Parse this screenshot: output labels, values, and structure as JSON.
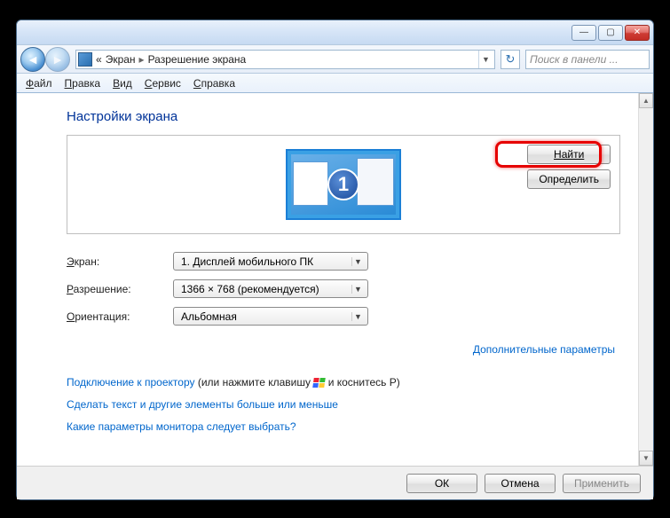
{
  "titlebar": {
    "min": "—",
    "max": "▢",
    "close": "✕"
  },
  "nav": {
    "back": "◄",
    "fwd": "►",
    "chevron": "«",
    "crumb1": "Экран",
    "crumb2": "Разрешение экрана",
    "refresh": "↻",
    "search_placeholder": "Поиск в панели ..."
  },
  "menu": {
    "file": "Файл",
    "edit": "Правка",
    "view": "Вид",
    "tools": "Сервис",
    "help": "Справка"
  },
  "page": {
    "title": "Настройки экрана",
    "display_number": "1",
    "find": "Найти",
    "detect": "Определить"
  },
  "form": {
    "display_label": "Экран:",
    "display_value": "1. Дисплей мобильного ПК",
    "resolution_label": "Разрешение:",
    "resolution_value": "1366 × 768 (рекомендуется)",
    "orientation_label": "Ориентация:",
    "orientation_value": "Альбомная",
    "advanced": "Дополнительные параметры"
  },
  "links": {
    "projector": "Подключение к проектору",
    "projector_tail1": " (или нажмите клавишу ",
    "projector_tail2": " и коснитесь P)",
    "textsize": "Сделать текст и другие элементы больше или меньше",
    "whichmonitor": "Какие параметры монитора следует выбрать?"
  },
  "footer": {
    "ok": "ОК",
    "cancel": "Отмена",
    "apply": "Применить"
  }
}
